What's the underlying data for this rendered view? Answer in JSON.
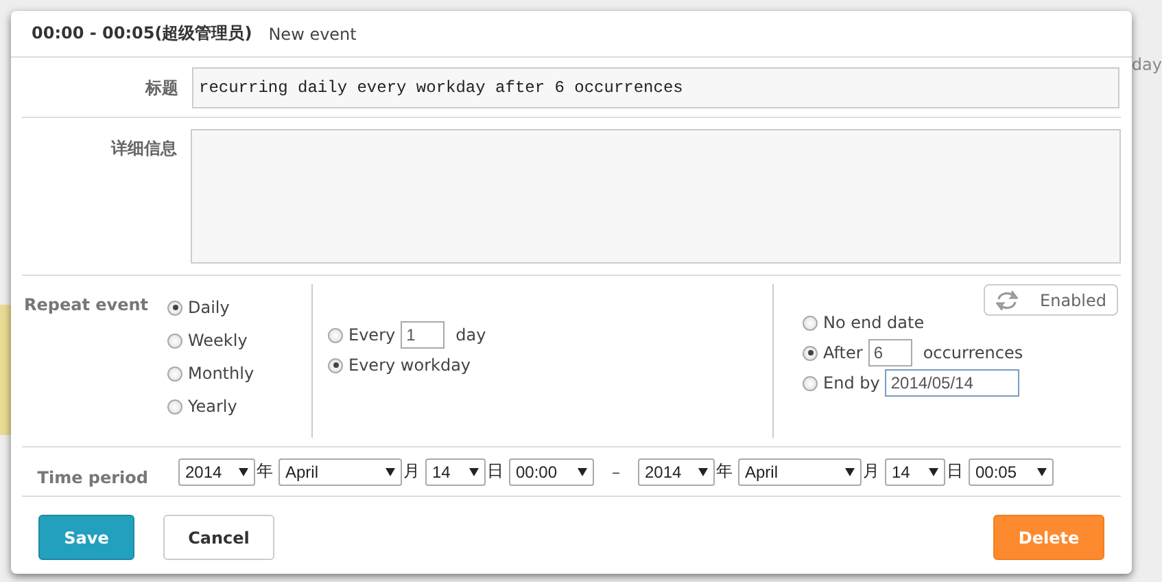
{
  "backdrop": {
    "side_text": "day"
  },
  "dialog": {
    "title": "00:00 - 00:05(超级管理员)",
    "subtitle": "New event",
    "fields": [
      {
        "label": "标题",
        "kind": "input",
        "value": "recurring daily every workday after 6 occurrences"
      },
      {
        "label": "详细信息",
        "kind": "textarea"
      }
    ],
    "repeat": {
      "label": "Repeat event",
      "types": [
        {
          "label": "Daily",
          "selected": true
        },
        {
          "label": "Weekly",
          "selected": false
        },
        {
          "label": "Monthly",
          "selected": false
        },
        {
          "label": "Yearly",
          "selected": false
        }
      ],
      "daily_options": [
        {
          "kind": "every",
          "prefix": "Every",
          "value": "1",
          "suffix": "day",
          "selected": false
        },
        {
          "kind": "plain",
          "prefix": "Every workday",
          "selected": true
        }
      ],
      "toggle": {
        "label": "Enabled",
        "on": true
      },
      "end_options": [
        {
          "kind": "plain",
          "prefix": "No end date",
          "selected": false
        },
        {
          "kind": "count",
          "prefix": "After",
          "value": "6",
          "suffix": "occurrences",
          "selected": true
        },
        {
          "kind": "date",
          "prefix": "End by",
          "value": "2014/05/14",
          "selected": false
        }
      ]
    },
    "time_period": {
      "label": "Time period",
      "separator": "–",
      "start": [
        {
          "value": "2014",
          "unit": "年"
        },
        {
          "value": "April",
          "unit": "月"
        },
        {
          "value": "14",
          "unit": "日"
        },
        {
          "value": "00:00"
        }
      ],
      "end": [
        {
          "value": "2014",
          "unit": "年"
        },
        {
          "value": "April",
          "unit": "月"
        },
        {
          "value": "14",
          "unit": "日"
        },
        {
          "value": "00:05"
        }
      ]
    },
    "buttons": [
      {
        "label": "Save",
        "kind": "primary"
      },
      {
        "label": "Cancel",
        "kind": "default"
      },
      {
        "label": "Delete",
        "kind": "danger"
      }
    ]
  }
}
